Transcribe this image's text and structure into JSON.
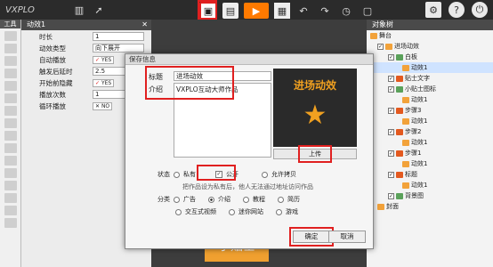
{
  "app": {
    "logo_text": "VXPLO"
  },
  "toolbar": {
    "icons": [
      "book-icon",
      "rocket-icon",
      "save-icon",
      "save-as-icon",
      "play-icon",
      "qrcode-icon",
      "undo-icon",
      "redo-icon",
      "history-icon",
      "screenshot-icon",
      "settings-icon",
      "help-icon",
      "power-icon"
    ]
  },
  "tools_panel": {
    "title": "工具"
  },
  "props_panel": {
    "title": "动效1",
    "rows": [
      {
        "label": "时长",
        "value": "1"
      },
      {
        "label": "动效类型",
        "value": "向下展开"
      },
      {
        "label": "自动播放",
        "value": "YES"
      },
      {
        "label": "触发后延时",
        "value": "2.5"
      },
      {
        "label": "开始前隐藏",
        "value": "YES"
      },
      {
        "label": "播放次数",
        "value": "1"
      },
      {
        "label": "循环播放",
        "value": "NO"
      }
    ]
  },
  "tree_panel": {
    "title": "对象树",
    "nodes": [
      {
        "label": "舞台",
        "depth": 0
      },
      {
        "label": "进场动效",
        "depth": 1
      },
      {
        "label": "白板",
        "depth": 2
      },
      {
        "label": "动效1",
        "depth": 3,
        "selected": true
      },
      {
        "label": "贴士文字",
        "depth": 2
      },
      {
        "label": "小贴士图标",
        "depth": 2
      },
      {
        "label": "动效1",
        "depth": 3
      },
      {
        "label": "步骤3",
        "depth": 2
      },
      {
        "label": "动效1",
        "depth": 3
      },
      {
        "label": "步骤2",
        "depth": 2
      },
      {
        "label": "动效1",
        "depth": 3
      },
      {
        "label": "步骤1",
        "depth": 2
      },
      {
        "label": "动效1",
        "depth": 3
      },
      {
        "label": "标题",
        "depth": 2
      },
      {
        "label": "动效1",
        "depth": 3
      },
      {
        "label": "背景图",
        "depth": 2
      },
      {
        "label": "封面",
        "depth": 1
      }
    ]
  },
  "canvas": {
    "sticker_text": "小贴士",
    "dots_text": "·:·:·"
  },
  "dialog": {
    "title": "保存信息",
    "title_label": "标题",
    "title_value": "进场动效",
    "intro_label": "介绍",
    "intro_value": "VXPLO互动大师作品",
    "preview_title": "进场动效",
    "upload_label": "上传",
    "status_label": "状态",
    "status_options": [
      "私有",
      "公开",
      "允许拷贝"
    ],
    "status_note": "把作品设为私有后，他人无法通过地址访问作品",
    "category_label": "分类",
    "category_row1": [
      "广告",
      "介绍",
      "教程",
      "简历"
    ],
    "category_row2": [
      "交互式视频",
      "迷你网站",
      "游戏"
    ],
    "ok_label": "确定",
    "cancel_label": "取消"
  },
  "colors": {
    "highlight": "#e02020",
    "accent_orange": "#ff7a00"
  }
}
